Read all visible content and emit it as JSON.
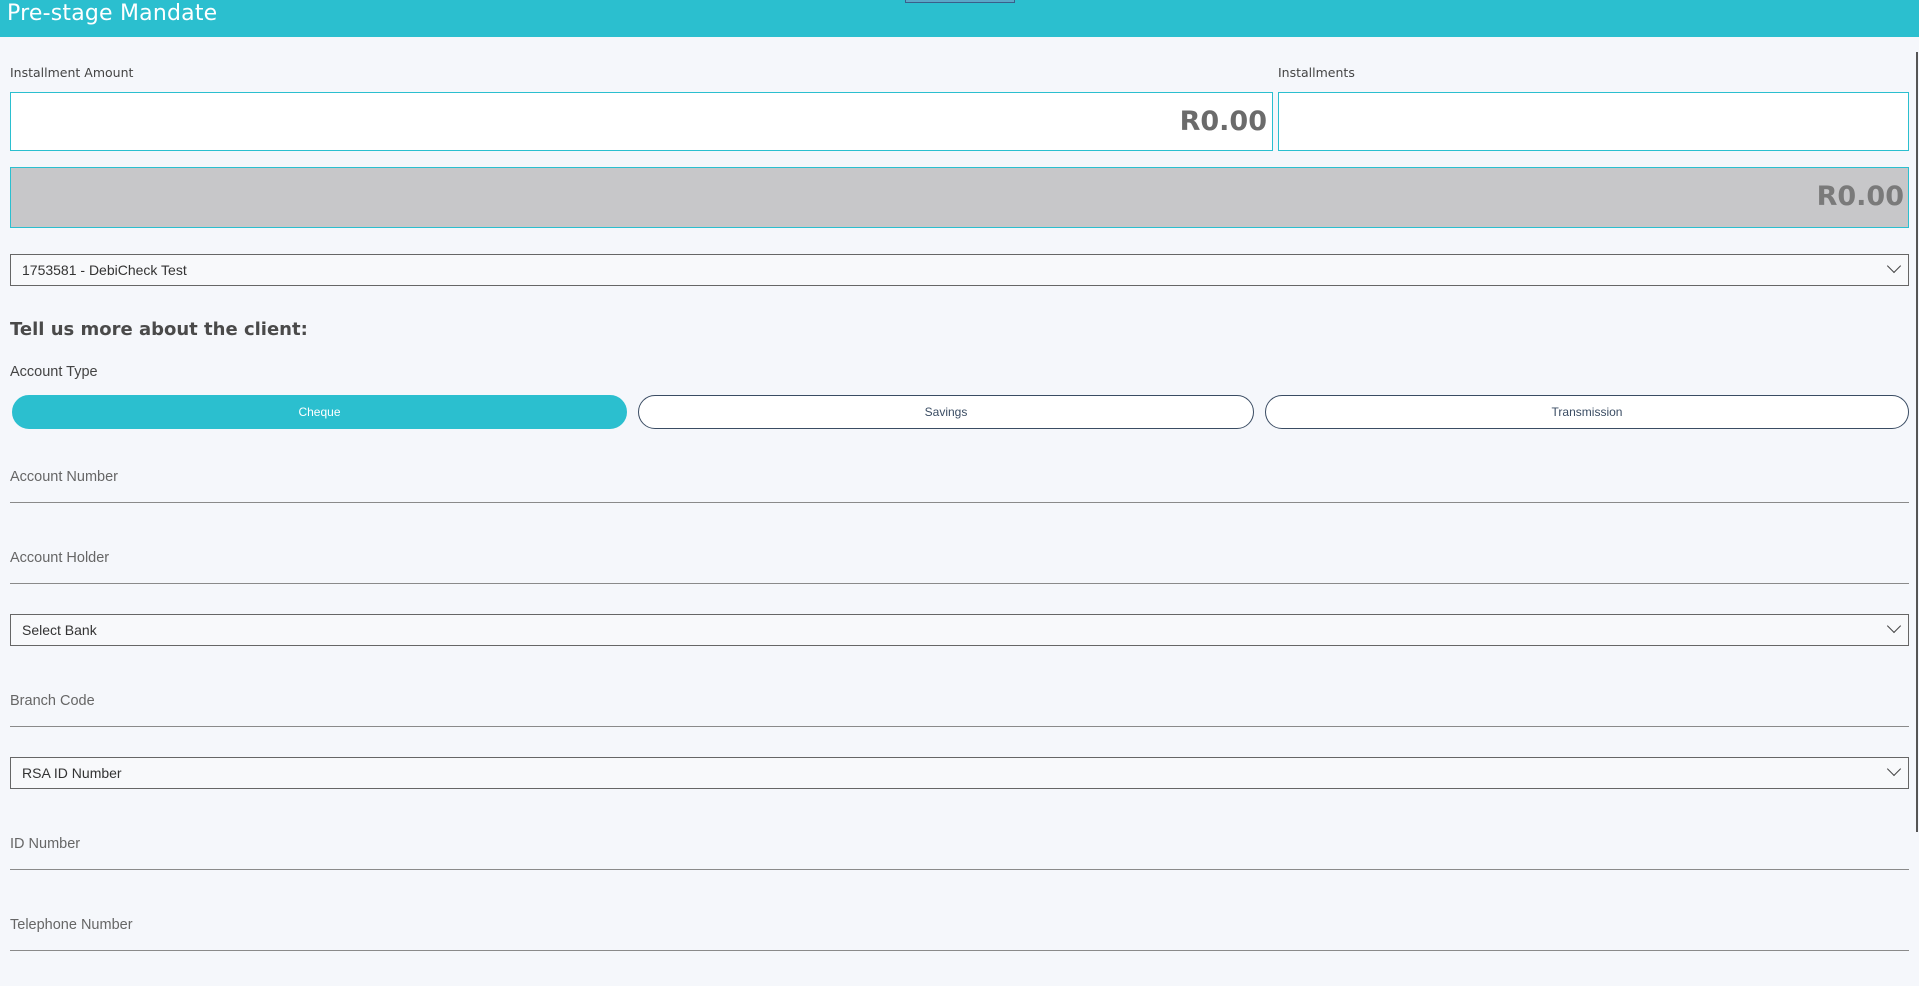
{
  "window": {
    "title": "Pre-stage Mandate"
  },
  "installment_amount": {
    "label": "Installment Amount",
    "value": "R0.00"
  },
  "installments": {
    "label": "Installments",
    "value": ""
  },
  "total": {
    "value": "R0.00"
  },
  "debicheck_select": {
    "selected": "1753581 - DebiCheck Test"
  },
  "client_section": {
    "heading": "Tell us more about the client:"
  },
  "account_type": {
    "label": "Account Type",
    "options": [
      "Cheque",
      "Savings",
      "Transmission"
    ],
    "selected": "Cheque"
  },
  "fields": {
    "account_number": {
      "placeholder": "Account Number"
    },
    "account_holder": {
      "placeholder": "Account Holder"
    },
    "branch_code": {
      "placeholder": "Branch Code"
    },
    "id_number": {
      "placeholder": "ID Number"
    },
    "telephone_number": {
      "placeholder": "Telephone Number"
    }
  },
  "bank_select": {
    "selected": "Select Bank"
  },
  "id_type_select": {
    "selected": "RSA ID Number"
  },
  "colors": {
    "accent": "#2bbfcf",
    "background": "#f5f7fb",
    "total_fill": "#c7c7c9"
  }
}
